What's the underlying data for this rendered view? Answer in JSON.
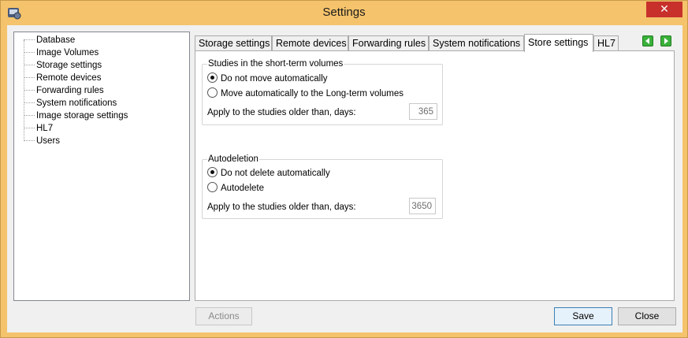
{
  "window": {
    "title": "Settings",
    "close_symbol": "✕"
  },
  "tree": {
    "items": [
      "Database",
      "Image Volumes",
      "Storage settings",
      "Remote devices",
      "Forwarding rules",
      "System notifications",
      "Image storage settings",
      "HL7",
      "Users"
    ]
  },
  "tabs": [
    "Storage settings",
    "Remote devices",
    "Forwarding rules",
    "System notifications",
    "Store settings",
    "HL7"
  ],
  "active_tab": "Store settings",
  "short_term": {
    "title": "Studies in the short-term volumes",
    "option1": "Do not move automatically",
    "option2": "Move automatically to the Long-term volumes",
    "selected": "option1",
    "days_label": "Apply to the studies older than, days:",
    "days_value": "365"
  },
  "autodeletion": {
    "title": "Autodeletion",
    "option1": "Do not delete automatically",
    "option2": "Autodelete",
    "selected": "option1",
    "days_label": "Apply to the studies older than, days:",
    "days_value": "3650"
  },
  "buttons": {
    "actions": "Actions",
    "save": "Save",
    "close": "Close"
  },
  "colors": {
    "title_bar": "#f5c36b",
    "close_button": "#c7302b",
    "nav_arrow": "#3bb03b"
  }
}
